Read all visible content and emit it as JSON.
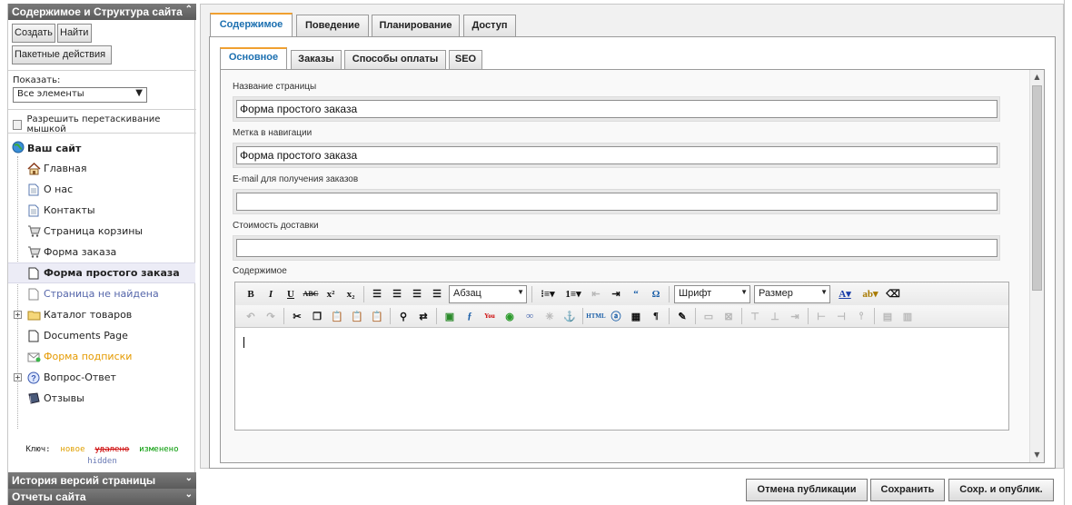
{
  "sidebar": {
    "title": "Содержимое и Структура сайта",
    "buttons": {
      "create": "Создать",
      "find": "Найти",
      "batch": "Пакетные действия"
    },
    "show_label": "Показать:",
    "show_value": "Все элементы",
    "drag_label": "Разрешить перетаскивание мышкой",
    "tree": {
      "root": "Ваш сайт",
      "items": [
        {
          "label": "Главная",
          "icon": "home-icon"
        },
        {
          "label": "О нас",
          "icon": "page-icon"
        },
        {
          "label": "Контакты",
          "icon": "page-icon"
        },
        {
          "label": "Страница корзины",
          "icon": "cart-icon"
        },
        {
          "label": "Форма заказа",
          "icon": "cart-icon"
        },
        {
          "label": "Форма простого заказа",
          "icon": "page-icon",
          "selected": true
        },
        {
          "label": "Страница не найдена",
          "icon": "page-icon",
          "state": "hidden"
        },
        {
          "label": "Каталог товаров",
          "icon": "folder-icon",
          "expandable": true
        },
        {
          "label": "Documents Page",
          "icon": "page-icon"
        },
        {
          "label": "Форма подписки",
          "icon": "mail-icon",
          "state": "new"
        },
        {
          "label": "Вопрос-Ответ",
          "icon": "help-icon",
          "expandable": true
        },
        {
          "label": "Отзывы",
          "icon": "book-icon"
        }
      ]
    },
    "legend": {
      "key": "Ключ:",
      "new": "новое",
      "deleted": "удалено",
      "changed": "изменено",
      "hidden": "hidden"
    },
    "history_title": "История версий страницы",
    "reports_title": "Отчеты сайта"
  },
  "main": {
    "tabs": [
      "Содержимое",
      "Поведение",
      "Планирование",
      "Доступ"
    ],
    "subtabs": [
      "Основное",
      "Заказы",
      "Способы оплаты",
      "SEO"
    ],
    "fields": {
      "page_name": {
        "label": "Название страницы",
        "value": "Форма простого заказа"
      },
      "nav_label": {
        "label": "Метка в навигации",
        "value": "Форма простого заказа"
      },
      "email": {
        "label": "E-mail для получения заказов",
        "value": ""
      },
      "delivery": {
        "label": "Стоимость доставки",
        "value": ""
      },
      "content": {
        "label": "Содержимое"
      }
    },
    "editor": {
      "format": "Абзац",
      "font": "Шрифт",
      "size": "Размер"
    }
  },
  "actions": {
    "unpublish": "Отмена публикации",
    "save": "Сохранить",
    "save_publish": "Сохр. и опублик."
  },
  "colors": {
    "accent": "#1b6fb0",
    "tab_highlight": "#f0a030",
    "new": "#e0a000",
    "deleted": "#cc0000",
    "changed": "#009900"
  }
}
